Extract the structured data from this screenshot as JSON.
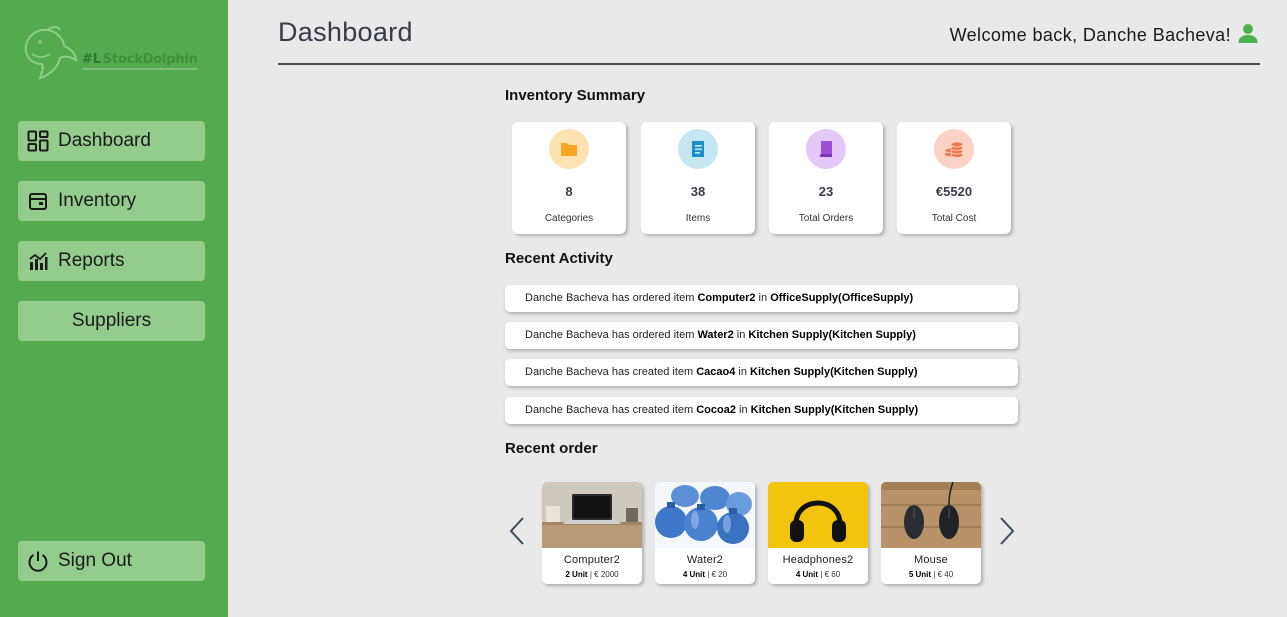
{
  "brand": {
    "name": "StockDolphin",
    "mark": "#L"
  },
  "sidebar": {
    "items": [
      {
        "label": "Dashboard",
        "icon": "dashboard-grid-icon"
      },
      {
        "label": "Inventory",
        "icon": "inventory-box-icon"
      },
      {
        "label": "Reports",
        "icon": "reports-chart-icon"
      },
      {
        "label": "Suppliers",
        "icon": ""
      }
    ],
    "signout": {
      "label": "Sign Out",
      "icon": "power-icon"
    }
  },
  "header": {
    "title": "Dashboard",
    "welcome": "Welcome back, Danche Bacheva!",
    "user_icon": "user-icon"
  },
  "summary": {
    "title": "Inventory Summary",
    "cards": [
      {
        "value": "8",
        "label": "Categories",
        "icon": "folder-icon",
        "circle": "#fde2b2",
        "color": "#f5a623"
      },
      {
        "value": "38",
        "label": "Items",
        "icon": "notebook-icon",
        "circle": "#c6e6f4",
        "color": "#1a8fc9"
      },
      {
        "value": "23",
        "label": "Total Orders",
        "icon": "book-icon",
        "circle": "#e4c8f7",
        "color": "#9b4fd6"
      },
      {
        "value": "€5520",
        "label": "Total Cost",
        "icon": "coins-icon",
        "circle": "#fbd3c6",
        "color": "#f07a50"
      }
    ]
  },
  "activity": {
    "title": "Recent Activity",
    "items": [
      {
        "prefix": "Danche Bacheva has ordered item ",
        "item": "Computer2",
        "mid": " in ",
        "location": "OfficeSupply(OfficeSupply)"
      },
      {
        "prefix": "Danche Bacheva has ordered item ",
        "item": "Water2",
        "mid": " in ",
        "location": "Kitchen Supply(Kitchen Supply)"
      },
      {
        "prefix": "Danche Bacheva has created item ",
        "item": "Cacao4",
        "mid": " in ",
        "location": "Kitchen Supply(Kitchen Supply)"
      },
      {
        "prefix": "Danche Bacheva has created item ",
        "item": "Cocoa2",
        "mid": " in ",
        "location": "Kitchen Supply(Kitchen Supply)"
      }
    ]
  },
  "orders": {
    "title": "Recent order",
    "items": [
      {
        "name": "Computer2",
        "units": "2 Unit",
        "sep": " | ",
        "price": "€ 2000"
      },
      {
        "name": "Water2",
        "units": "4 Unit",
        "sep": " | ",
        "price": "€ 20"
      },
      {
        "name": "Headphones2",
        "units": "4 Unit",
        "sep": " | ",
        "price": "€ 60"
      },
      {
        "name": "Mouse",
        "units": "5 Unit",
        "sep": " | ",
        "price": "€ 40"
      }
    ]
  },
  "colors": {
    "sidebar": "#54ab4e",
    "nav_button": "#94cc8e",
    "background": "#e9e9e9",
    "accent_user": "#4caf50"
  }
}
